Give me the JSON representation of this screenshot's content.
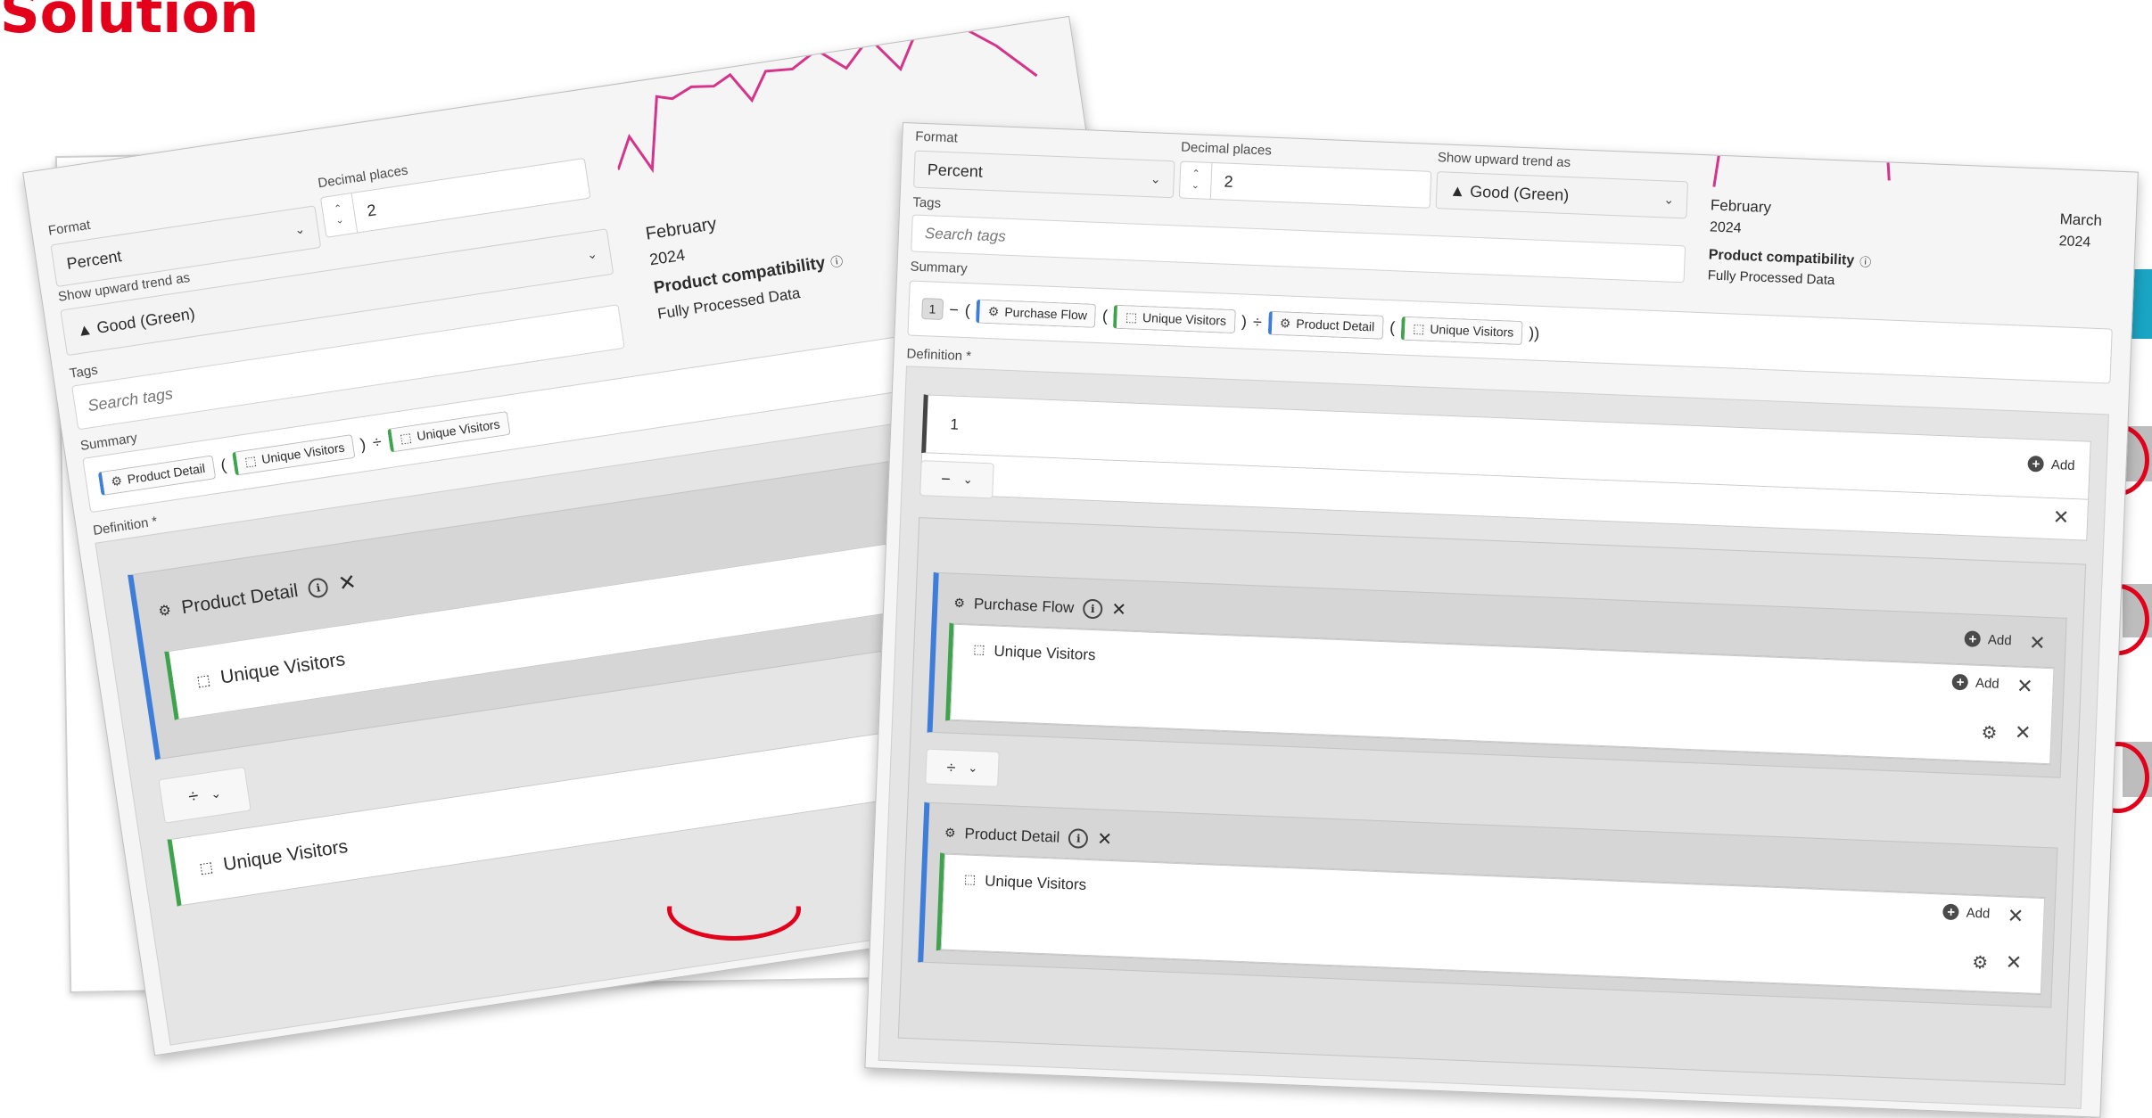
{
  "slide": {
    "title": "Solution"
  },
  "left_panel": {
    "format_label": "Format",
    "format_value": "Percent",
    "decimal_label": "Decimal places",
    "decimal_value": "2",
    "trend_label": "Show upward trend as",
    "trend_value": "▲ Good (Green)",
    "tags_label": "Tags",
    "tags_placeholder": "Search tags",
    "summary_label": "Summary",
    "summary_tokens": {
      "c1": "Product Detail",
      "c2": "Unique Visitors",
      "c3": "Unique Visitors",
      "p_open": "(",
      "p_close": ")",
      "op": "÷"
    },
    "definition_label": "Definition *",
    "date_month": "February",
    "date_year": "2024",
    "compat_title": "Product compatibility",
    "compat_value": "Fully Processed Data",
    "def_rows": {
      "metric": "Product Detail",
      "dim_inner": "Unique Visitors",
      "operator": "÷",
      "dim_outer": "Unique Visitors"
    }
  },
  "right_panel": {
    "format_label": "Format",
    "format_value": "Percent",
    "decimal_label": "Decimal places",
    "decimal_value": "2",
    "trend_label": "Show upward trend as",
    "trend_value": "▲ Good (Green)",
    "tags_label": "Tags",
    "tags_placeholder": "Search tags",
    "summary_label": "Summary",
    "summary_tokens": {
      "num": "1",
      "minus": "−",
      "p1": "(",
      "c1": "Purchase Flow",
      "p2": "(",
      "c2": "Unique Visitors",
      "p3": ")",
      "div": "÷",
      "c3": "Product Detail",
      "p4": "(",
      "c4": "Unique Visitors",
      "p5": "))"
    },
    "definition_label": "Definition *",
    "date_feb": "February",
    "date_feb_year": "2024",
    "date_mar": "March",
    "date_mar_year": "2024",
    "compat_title": "Product compatibility",
    "compat_value": "Fully Processed Data",
    "static_number": "1",
    "operator": "−",
    "divide_operator": "÷",
    "add_label": "Add",
    "purchase_flow": "Purchase Flow",
    "product_detail": "Product Detail",
    "unique_visitors": "Unique Visitors"
  },
  "colors": {
    "title_red": "#e3001b",
    "metric_blue": "#3f7ed8",
    "dimension_green": "#3fa34d",
    "chart_pink": "#d6338a"
  },
  "icons": [
    "chevron-down-icon",
    "stepper-icon",
    "metric-icon",
    "segment-icon",
    "info-icon",
    "close-icon",
    "add-icon",
    "gear-icon",
    "drag-handle-icon"
  ]
}
